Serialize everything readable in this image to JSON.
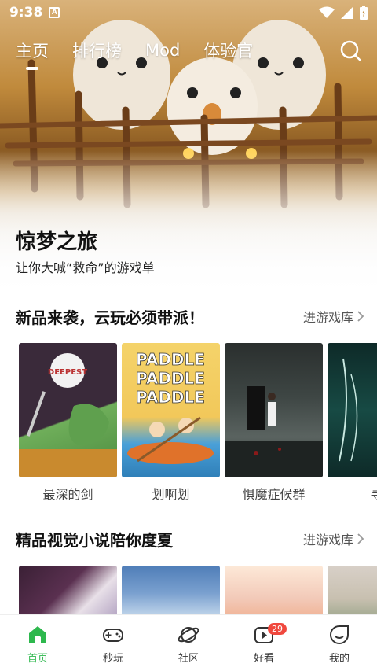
{
  "status_bar": {
    "time": "9:38",
    "notification_icon_letter": "A"
  },
  "top_nav": {
    "tabs": [
      {
        "label": "主页",
        "active": true
      },
      {
        "label": "排行榜",
        "active": false
      },
      {
        "label": "Mod",
        "active": false
      },
      {
        "label": "体验官",
        "active": false
      }
    ],
    "search_icon": "search-icon"
  },
  "hero": {
    "title": "惊梦之旅",
    "subtitle": "让你大喊“救命”的游戏单"
  },
  "section_new": {
    "title": "新品来袭，云玩必须带派！",
    "more": "进游戏库",
    "games": [
      {
        "name": "最深的剑",
        "cover_text": "DEEPEST SWORD",
        "cover_colors": [
          "#3a2a3a",
          "#6fae5a"
        ]
      },
      {
        "name": "划啊划",
        "cover_text": "PADDLE PADDLE PADDLE",
        "cover_colors": [
          "#f4d36a",
          "#4aa0d8"
        ]
      },
      {
        "name": "惧魔症候群",
        "cover_colors": [
          "#2a2f2e",
          "#5a6360"
        ]
      },
      {
        "name": "寻",
        "cover_colors": [
          "#0e2a28",
          "#1f6b60"
        ]
      }
    ]
  },
  "section_novel": {
    "title": "精品视觉小说陪你度夏",
    "more": "进游戏库",
    "covers": [
      {
        "cover_colors": [
          "#3a2035",
          "#e8e0e8"
        ]
      },
      {
        "cover_colors": [
          "#4f7db8",
          "#cfe0f0"
        ]
      },
      {
        "cover_colors": [
          "#f2c9b8",
          "#fde9d8"
        ]
      },
      {
        "cover_colors": [
          "#d8d0c8",
          "#9aa58a"
        ]
      }
    ]
  },
  "bottom_nav": {
    "items": [
      {
        "label": "首页",
        "icon": "home-icon",
        "active": true
      },
      {
        "label": "秒玩",
        "icon": "gamepad-icon",
        "active": false
      },
      {
        "label": "社区",
        "icon": "planet-icon",
        "active": false
      },
      {
        "label": "好看",
        "icon": "video-icon",
        "active": false,
        "badge": "29"
      },
      {
        "label": "我的",
        "icon": "profile-icon",
        "active": false
      }
    ]
  },
  "colors": {
    "accent": "#2db84d",
    "badge": "#f0483e"
  }
}
